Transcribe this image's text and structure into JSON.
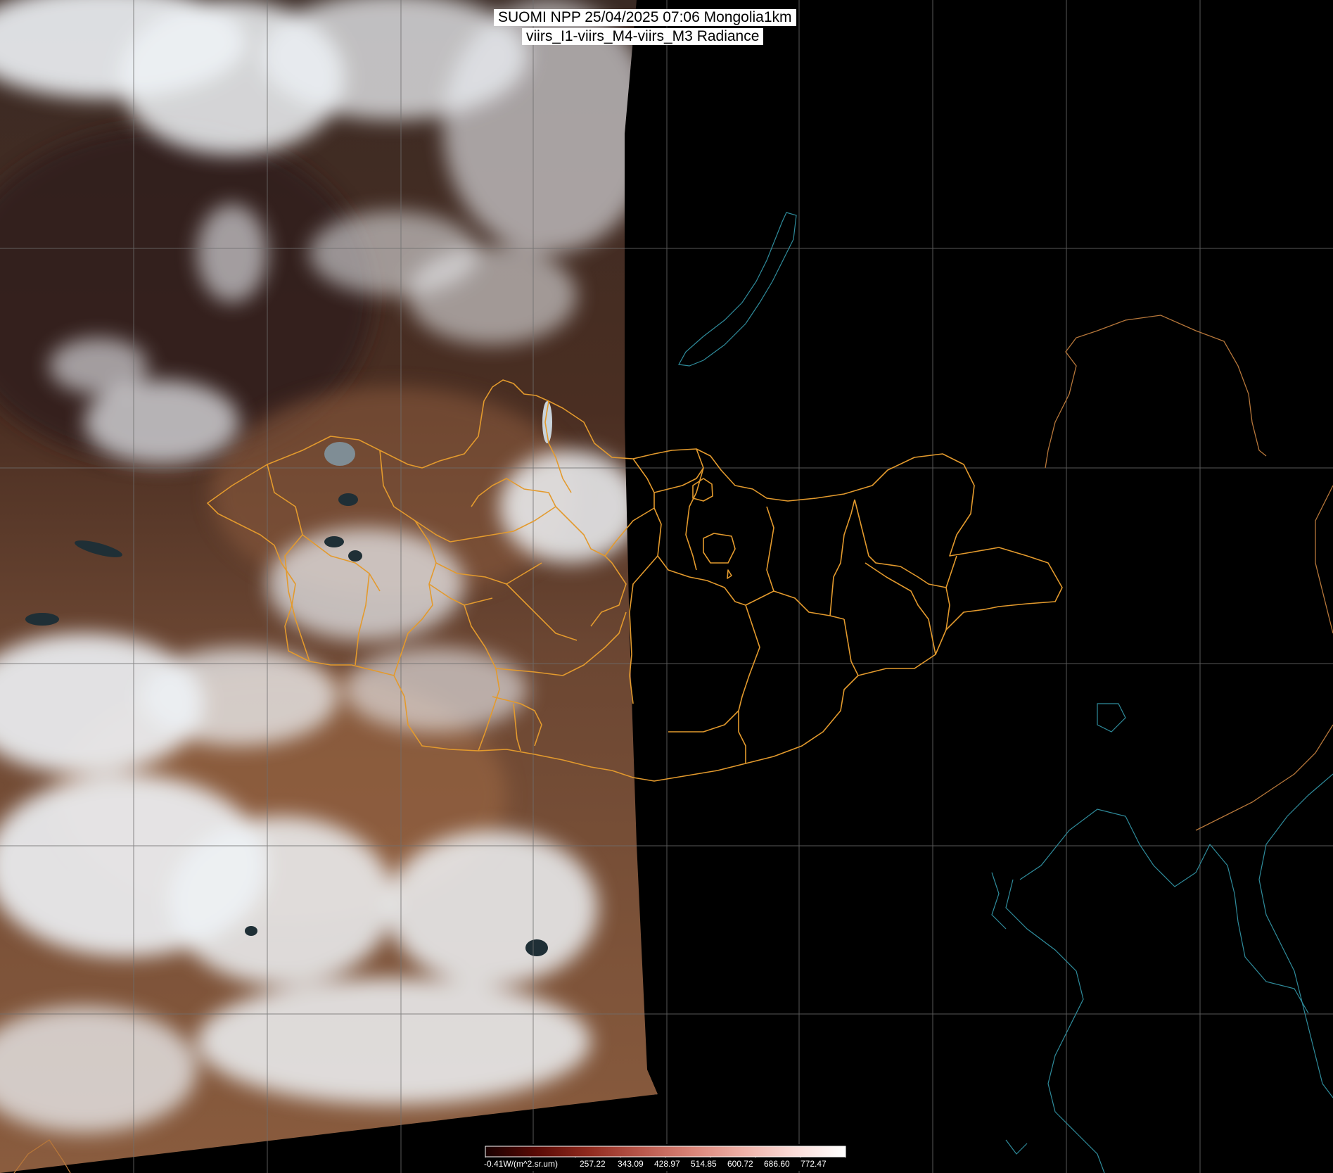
{
  "title": {
    "line1": "SUOMI NPP 25/04/2025 07:06 Mongolia1km",
    "line2": "viirs_I1-viirs_M4-viirs_M3 Radiance"
  },
  "colors": {
    "background": "#000000",
    "graticule": "#6e6e6e",
    "boundary": "#e39a2d",
    "coastline": "#2f8c9c",
    "cloud": "#eef2f6",
    "land_brown": "#6a4330"
  },
  "legend": {
    "unit_label": "-0.41W/(m^2.sr.um)",
    "ticks": [
      "257.22",
      "343.09",
      "428.97",
      "514.85",
      "600.72",
      "686.60",
      "772.47"
    ],
    "gradient": [
      "#1a0000",
      "#5a0a05",
      "#8f2a1e",
      "#b8564a",
      "#d98377",
      "#efb1a8",
      "#fbdcd8",
      "#ffffff"
    ]
  }
}
